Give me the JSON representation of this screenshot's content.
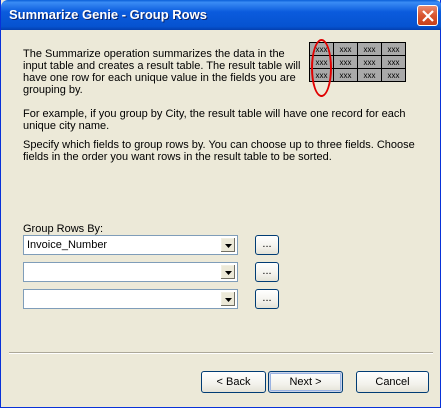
{
  "window": {
    "title": "Summarize Genie - Group Rows"
  },
  "description": {
    "para1": "The Summarize operation summarizes the data in the input table and creates a result table. The result table will have one row for each unique value in the fields you are grouping by.",
    "para2": "For example, if you group by City, the result table will have one record for each unique city name.",
    "para3": "Specify which fields to group rows by. You can choose up to three fields. Choose fields in the order you want rows in the result table to be sorted."
  },
  "illustration": {
    "cell_text": "xxx",
    "rows": 3,
    "cols": 4,
    "highlight_color": "#e00000"
  },
  "group_rows": {
    "label": "Group Rows By:",
    "fields": [
      "Invoice_Number",
      "",
      ""
    ],
    "browse_label": "..."
  },
  "buttons": {
    "back": "< Back",
    "next": "Next >",
    "cancel": "Cancel"
  }
}
